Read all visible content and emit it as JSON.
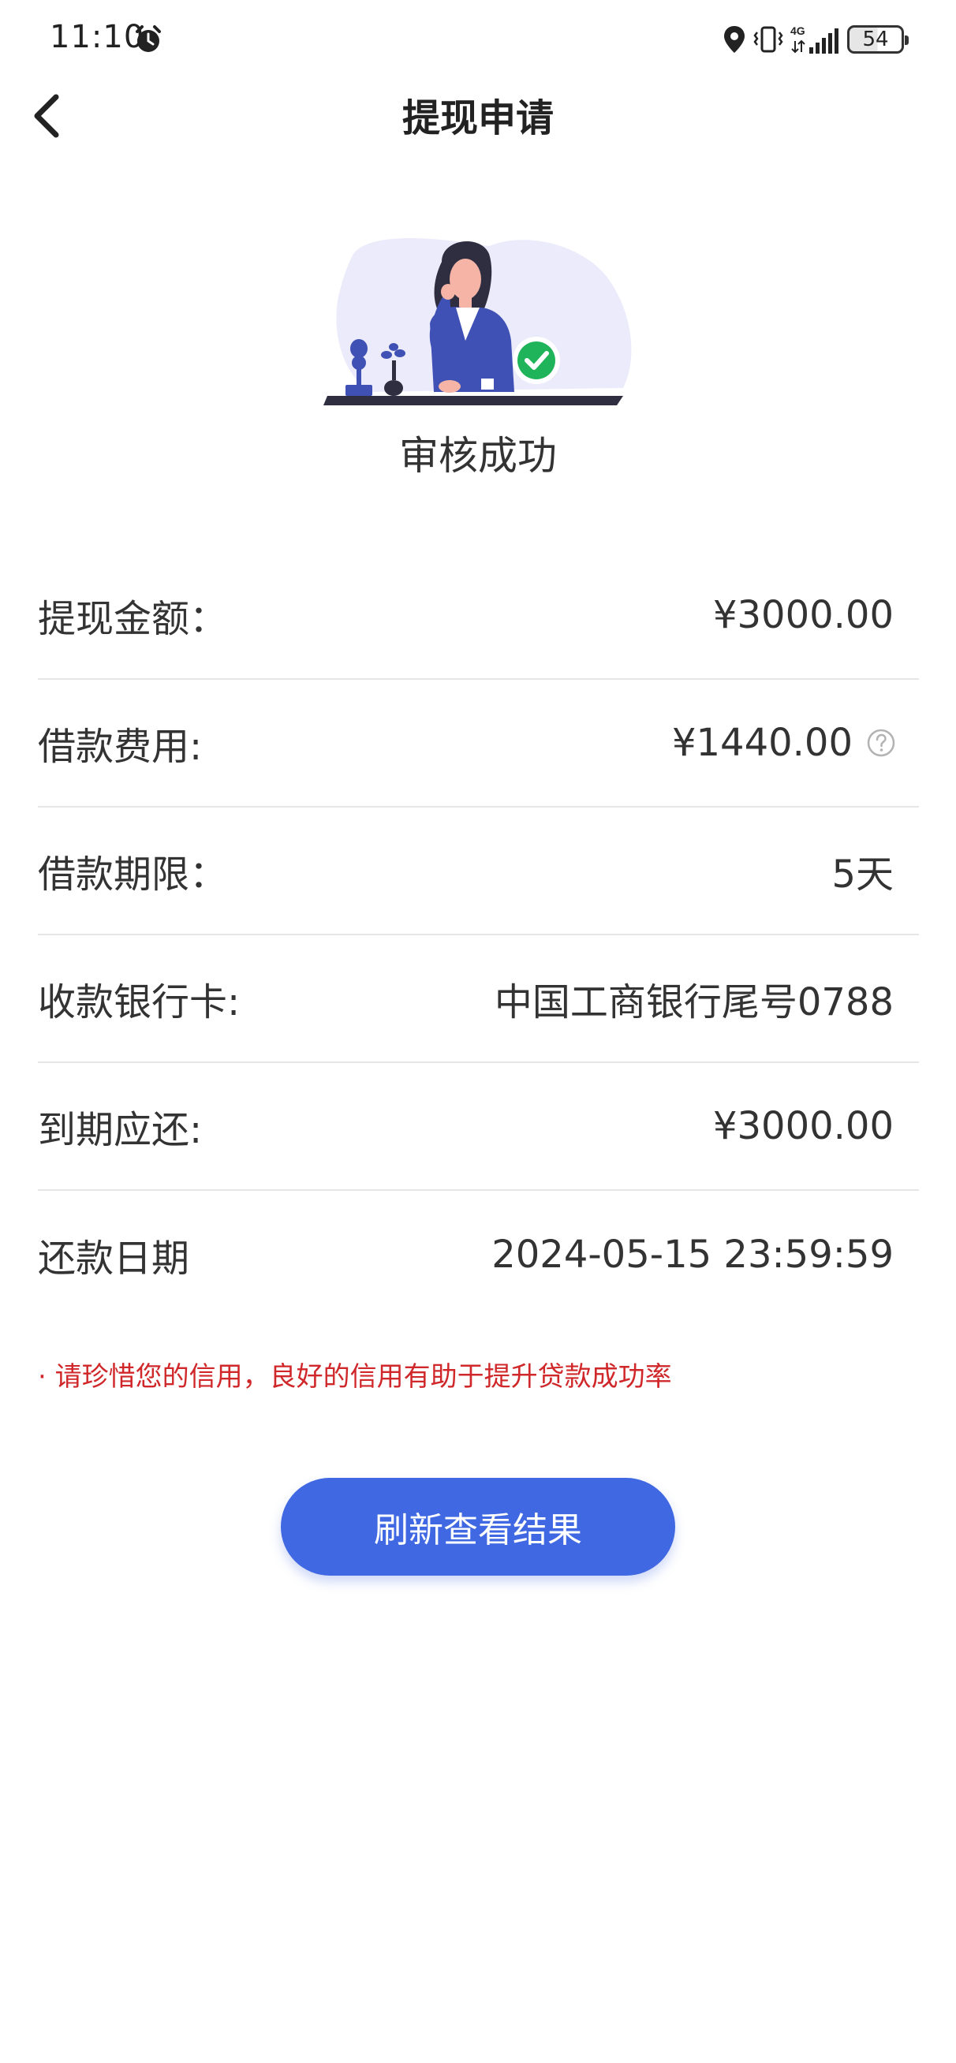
{
  "status_bar": {
    "time": "11:10",
    "network": "4G",
    "battery": "54"
  },
  "header": {
    "title": "提现申请"
  },
  "result": {
    "title": "审核成功"
  },
  "details": {
    "rows": [
      {
        "label": "提现金额：",
        "value": "¥3000.00"
      },
      {
        "label": "借款费用:",
        "value": "¥1440.00"
      },
      {
        "label": "借款期限：",
        "value": "5天"
      },
      {
        "label": "收款银行卡:",
        "value": "中国工商银行尾号0788"
      },
      {
        "label": "到期应还:",
        "value": "¥3000.00"
      },
      {
        "label": "还款日期",
        "value": "2024-05-15 23:59:59"
      }
    ]
  },
  "notice": "· 请珍惜您的信用，良好的信用有助于提升贷款成功率",
  "actions": {
    "refresh_label": "刷新查看结果"
  },
  "colors": {
    "accent": "#4068e2",
    "notice": "#d0282a",
    "success": "#20b45a"
  }
}
